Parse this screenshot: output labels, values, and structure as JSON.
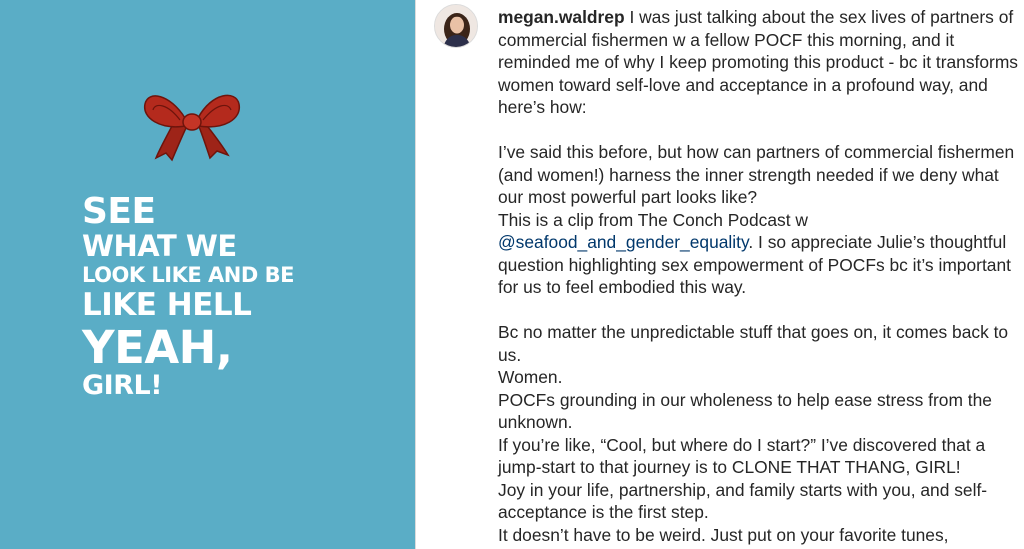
{
  "left_panel": {
    "background": "#5aadc6",
    "bow_icon": "red-bow-icon",
    "headline_lines": [
      "SEE",
      "WHAT WE",
      "LOOK LIKE AND BE",
      "LIKE HELL",
      "YEAH,",
      "GIRL!"
    ]
  },
  "post": {
    "username": "megan.waldrep",
    "caption": {
      "p1": "I was just talking about the sex lives of partners of commercial fishermen w a fellow POCF this morning, and it reminded me of why I keep promoting this product - bc it transforms women toward self-love and acceptance in a profound way, and here’s how:",
      "p2_a": "I’ve said this before, but how can partners of commercial fishermen (and women!) harness the inner strength needed if we deny what our most powerful part looks like?",
      "p2_b": "This is a clip from The Conch Podcast w",
      "mention": "@seafood_and_gender_equality",
      "p2_c": ". I so appreciate Julie’s thoughtful question highlighting sex empowerment of POCFs bc it’s important for us to feel embodied this way.",
      "p3_a": "Bc no matter the unpredictable stuff that goes on, it comes back to us.",
      "p3_b": "Women.",
      "p3_c": "POCFs grounding in our wholeness to help ease stress from the unknown.",
      "p3_d": "If you’re like, “Cool, but where do I start?” I’ve discovered that a jump-start to that journey is to CLONE THAT THANG, GIRL!",
      "p3_e": "Joy in your life, partnership, and family starts with you, and self-acceptance is the first step.",
      "p3_f": "It doesn’t have to be weird. Just put on your favorite tunes,"
    }
  },
  "colors": {
    "accent_blue_panel": "#5aadc6",
    "mention": "#00376b",
    "text": "#262626",
    "bow_red": "#b42a1d"
  }
}
